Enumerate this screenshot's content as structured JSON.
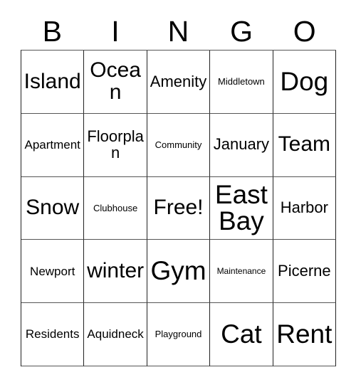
{
  "header": {
    "letters": [
      "B",
      "I",
      "N",
      "G",
      "O"
    ]
  },
  "grid": {
    "rows": [
      [
        {
          "text": "Island",
          "size": "lg"
        },
        {
          "text": "Ocean",
          "size": "lg"
        },
        {
          "text": "Amenity",
          "size": "md"
        },
        {
          "text": "Middletown",
          "size": "xs"
        },
        {
          "text": "Dog",
          "size": "xl"
        }
      ],
      [
        {
          "text": "Apartment",
          "size": "sm"
        },
        {
          "text": "Floorplan",
          "size": "md"
        },
        {
          "text": "Community",
          "size": "xs"
        },
        {
          "text": "January",
          "size": "md"
        },
        {
          "text": "Team",
          "size": "lg"
        }
      ],
      [
        {
          "text": "Snow",
          "size": "lg"
        },
        {
          "text": "Clubhouse",
          "size": "xs"
        },
        {
          "text": "Free!",
          "size": "lg"
        },
        {
          "text": "East Bay",
          "size": "xl"
        },
        {
          "text": "Harbor",
          "size": "md"
        }
      ],
      [
        {
          "text": "Newport",
          "size": "sm"
        },
        {
          "text": "winter",
          "size": "lg"
        },
        {
          "text": "Gym",
          "size": "xl"
        },
        {
          "text": "Maintenance",
          "size": "xxs"
        },
        {
          "text": "Picerne",
          "size": "md"
        }
      ],
      [
        {
          "text": "Residents",
          "size": "sm"
        },
        {
          "text": "Aquidneck",
          "size": "sm"
        },
        {
          "text": "Playground",
          "size": "xs"
        },
        {
          "text": "Cat",
          "size": "xl"
        },
        {
          "text": "Rent",
          "size": "xl"
        }
      ]
    ]
  },
  "colors": {
    "background": "#ffffff",
    "text": "#000000",
    "border_vertical": "#222222",
    "border_horizontal": "#555555"
  }
}
